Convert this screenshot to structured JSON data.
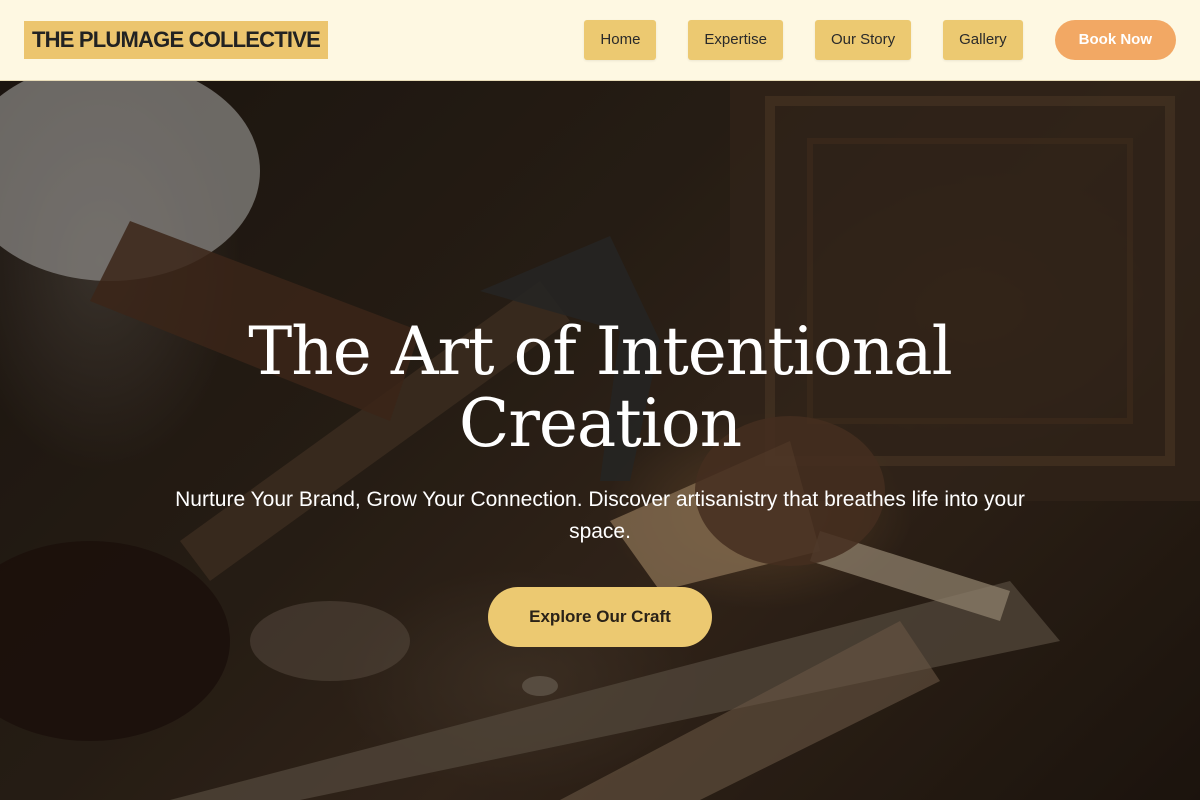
{
  "brand": {
    "name": "THE PLUMAGE COLLECTIVE"
  },
  "nav": {
    "links": [
      "Home",
      "Expertise",
      "Our Story",
      "Gallery"
    ],
    "cta_label": "Book Now"
  },
  "hero": {
    "title": "The Art of Intentional Creation",
    "subtitle": "Nurture Your Brand, Grow Your Connection. Discover artisanistry that breathes life into your space.",
    "cta_label": "Explore Our Craft",
    "image_subject": "woodcarving-artisan-photo"
  },
  "colors": {
    "nav_background": "#fef8e2",
    "accent_yellow": "#ecc971",
    "accent_orange": "#f2a864",
    "text_dark": "#222222",
    "hero_text": "#ffffff"
  }
}
